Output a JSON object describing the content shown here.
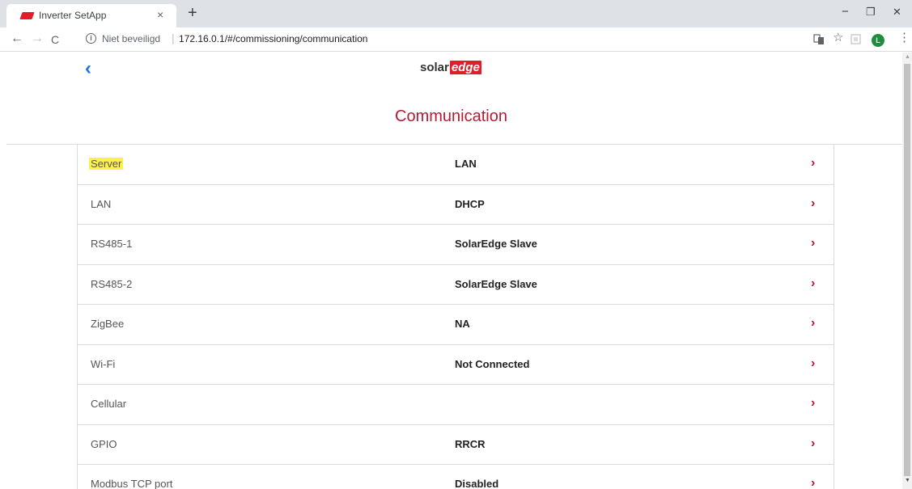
{
  "browser": {
    "tab_title": "Inverter SetApp",
    "tab_close": "×",
    "new_tab": "+",
    "minimize": "−",
    "restore": "❐",
    "close": "✕",
    "back": "←",
    "forward": "→",
    "reload": "C",
    "not_secure": "Niet beveiligd",
    "separator": "|",
    "url": "172.16.0.1/#/commissioning/communication",
    "translate_icon": "translate-icon",
    "star_icon": "star-icon",
    "avatar_letter": "L",
    "menu": "⋮"
  },
  "page": {
    "back": "‹",
    "logo_solar": "solar",
    "logo_edge": "edge",
    "title": "Communication",
    "accent": "#b31b34"
  },
  "rows": [
    {
      "label": "Server",
      "value": "LAN"
    },
    {
      "label": "LAN",
      "value": "DHCP"
    },
    {
      "label": "RS485-1",
      "value": "SolarEdge Slave"
    },
    {
      "label": "RS485-2",
      "value": "SolarEdge Slave"
    },
    {
      "label": "ZigBee",
      "value": "NA"
    },
    {
      "label": "Wi-Fi",
      "value": "Not Connected"
    },
    {
      "label": "Cellular",
      "value": ""
    },
    {
      "label": "GPIO",
      "value": "RRCR"
    },
    {
      "label": "Modbus TCP port",
      "value": "Disabled"
    }
  ],
  "chevron": "›"
}
